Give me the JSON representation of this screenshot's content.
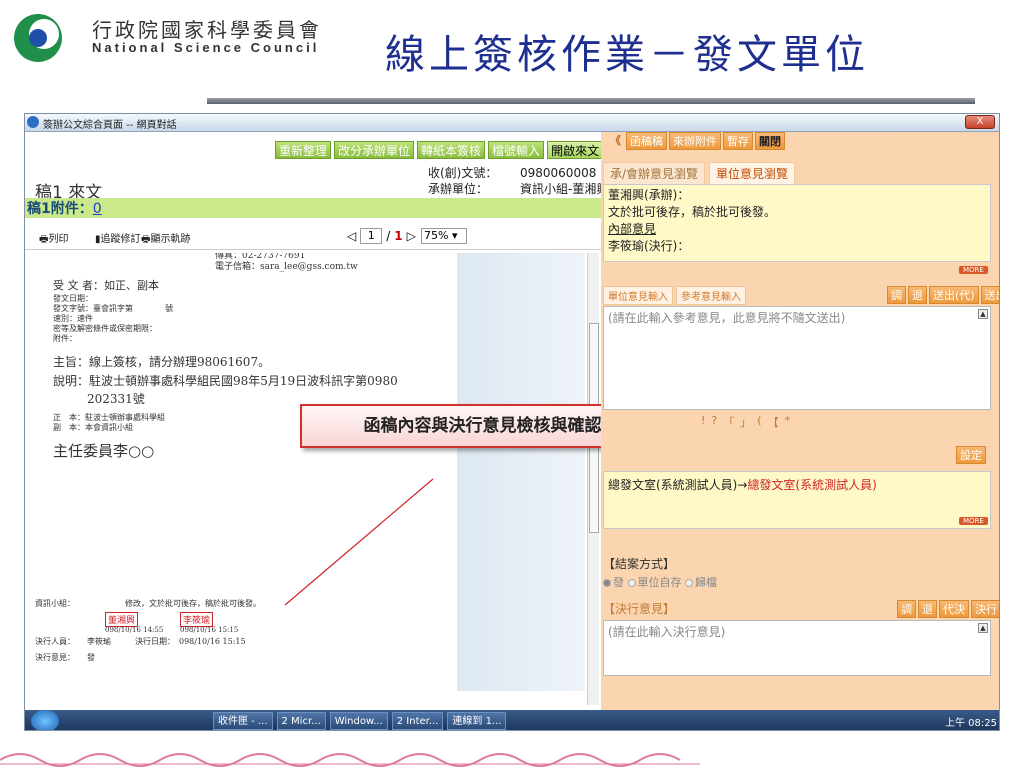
{
  "slide": {
    "org_cn": "行政院國家科學委員會",
    "org_en": "National Science Council",
    "title": "線上簽核作業－發文單位"
  },
  "window": {
    "title": "簽辦公文綜合頁面 -- 網頁對話",
    "close": "X"
  },
  "left": {
    "buttons": [
      "重新整理",
      "改分承辦單位",
      "轉紙本簽核",
      "檔號輸入",
      "開啟來文"
    ],
    "doc_no_label": "收(創)文號：",
    "doc_no_value": "0980060008",
    "unit_label": "承辦單位：",
    "unit_value": "資訊小組-董湘興",
    "draft_label": "稿1",
    "draft_type": "來文",
    "attach_label": "稿1附件：",
    "attach_count": "0",
    "toolbar": {
      "print": "列印",
      "track": "追蹤修訂",
      "show_trace": "顯示軌跡",
      "page_current": "1",
      "page_sep": "/",
      "page_total": "1",
      "zoom": "75%"
    }
  },
  "document": {
    "fax": "傳真：02-2737-7691",
    "email": "電子信箱：sara_lee@gss.com.tw",
    "recipient": "受 文 者：如正、副本",
    "date": "發文日期：",
    "number": "發文字號：臺會訊字第　　　　號",
    "speed": "速別：速件",
    "secret": "密等及解密條件或保密期限：",
    "attach": "附件：",
    "subject": "主旨：線上簽核，請分辦理98061607。",
    "desc1": "說明：駐波士頓辦事處科學組民國98年5月19日波科訊字第0980",
    "desc2": "202331號",
    "main_copy": "正　本：駐波士頓辦事處科學組",
    "cc": "副　本：本會資訊小組",
    "signer": "主任委員李○○",
    "footer_unit": "資訊小組：",
    "footer_note": "修改，文於批可後存，稿於批可後發。",
    "stamp1": "董湘興",
    "stamp2": "李筱瑜",
    "stamp_date1": "098/10/16 14:55",
    "stamp_date2": "098/10/16 15:15",
    "decider": "決行人員：　　李筱瑜　　　決行日期：　098/10/16 15:15",
    "decision": "決行意見：　　發"
  },
  "callout": "函稿內容與決行意見檢核與確認",
  "right": {
    "buttons": [
      "《",
      "函稿稿",
      "來辦附件",
      "暫存",
      "關閉"
    ],
    "tabs": [
      "承/會辦意見瀏覽",
      "單位意見瀏覽"
    ],
    "opinion_line1": "董湘興(承辦)：",
    "opinion_line2": "文於批可後存，稿於批可後發。",
    "opinion_link": "內部意見",
    "opinion_line3": "李筱瑜(決行)：",
    "more": "MORE",
    "input_tabs": [
      "單位意見輸入",
      "參考意見輸入"
    ],
    "input_buttons": [
      "調",
      "退",
      "送出(代)",
      "送出"
    ],
    "input_placeholder": "(請在此輸入參考意見，此意見將不隨文送出)",
    "symbols": [
      "!",
      "?",
      "「",
      "」",
      "(",
      "【",
      "*"
    ],
    "flow_button": "設定",
    "flow_text_a": "總發文室(系統測試人員)→",
    "flow_text_b": "總發文室(系統測試人員)",
    "case_label": "【結案方式】",
    "case_options": [
      "發",
      "單位自存",
      "歸檔"
    ],
    "decide_label": "【決行意見】",
    "decide_buttons": [
      "調",
      "退",
      "代決",
      "決行"
    ],
    "decide_placeholder": "(請在此輸入決行意見)"
  },
  "taskbar": {
    "items": [
      "收件匣 - ...",
      "2 Micr...",
      "Window...",
      "2 Inter...",
      "連線到 1..."
    ],
    "clock": "上午 08:25"
  }
}
